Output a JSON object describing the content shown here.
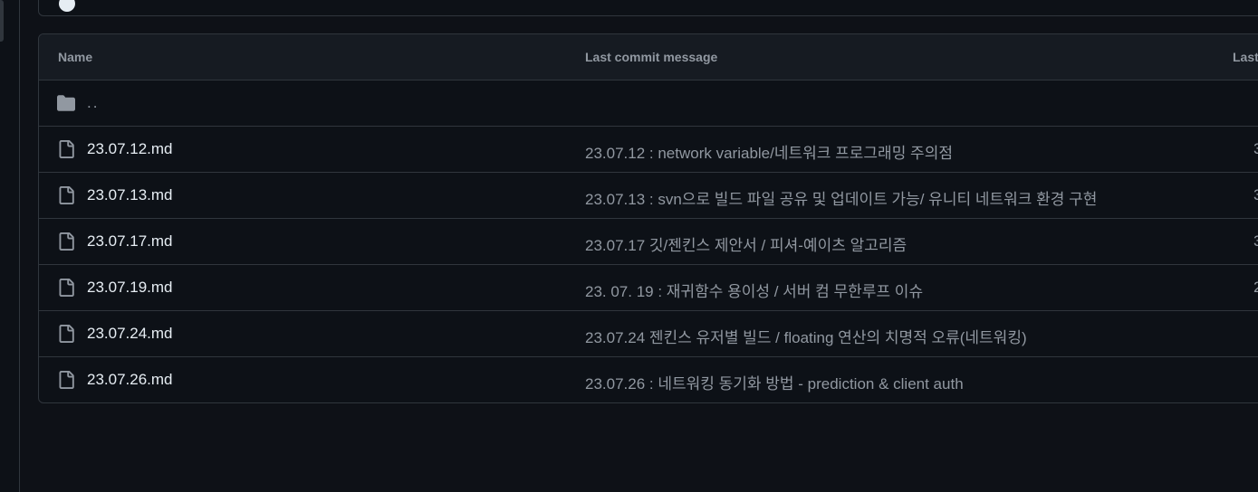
{
  "table": {
    "headers": {
      "name": "Name",
      "message": "Last commit message",
      "date": "Last"
    },
    "parent_row": {
      "name": ".."
    },
    "rows": [
      {
        "name": "23.07.12.md",
        "message": "23.07.12 : network variable/네트워크 프로그래밍 주의점",
        "date": "3"
      },
      {
        "name": "23.07.13.md",
        "message": "23.07.13 : svn으로 빌드 파일 공유 및 업데이트 가능/ 유니티 네트워크 환경 구현",
        "date": "3"
      },
      {
        "name": "23.07.17.md",
        "message": "23.07.17 깃/젠킨스 제안서 / 피셔-예이츠 알고리즘",
        "date": "3"
      },
      {
        "name": "23.07.19.md",
        "message": "23. 07. 19 : 재귀함수 용이성 / 서버 컴 무한루프 이슈",
        "date": "2"
      },
      {
        "name": "23.07.24.md",
        "message": "23.07.24 젠킨스 유저별 빌드 / floating 연산의 치명적 오류(네트워킹)",
        "date": ""
      },
      {
        "name": "23.07.26.md",
        "message": "23.07.26 : 네트워킹 동기화 방법 - prediction & client auth",
        "date": ""
      }
    ]
  },
  "colors": {
    "background": "#0e1117",
    "border": "#30363d",
    "header_bg": "#161b22",
    "text_primary": "#e6edf3",
    "text_muted": "#9198a1",
    "folder_icon": "#9198a1"
  },
  "icons": {
    "parent": "folder-icon",
    "file": "file-icon"
  }
}
